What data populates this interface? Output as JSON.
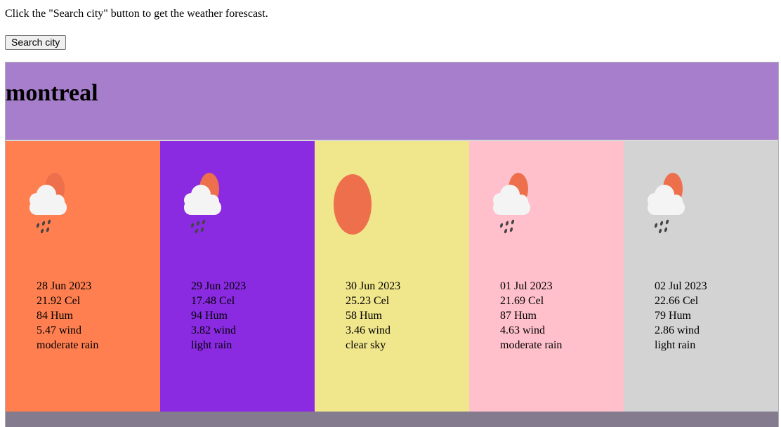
{
  "intro_text": "Click the \"Search city\" button to get the weather forescast.",
  "search_button": "Search city",
  "city": "montreal",
  "colors": {
    "header": "#a67ecb",
    "footer": "#857b8f",
    "sun": "#ee6f4c",
    "cloud": "#f4f4f4"
  },
  "days": [
    {
      "date": "28 Jun 2023",
      "temp": "21.92 Cel",
      "hum": "84 Hum",
      "wind": "5.47 wind",
      "desc": "moderate rain",
      "icon": "rain-cloud-sun-icon",
      "color": "#ff7f50"
    },
    {
      "date": "29 Jun 2023",
      "temp": "17.48 Cel",
      "hum": "94 Hum",
      "wind": "3.82 wind",
      "desc": "light rain",
      "icon": "rain-cloud-sun-icon",
      "color": "#8a2be2"
    },
    {
      "date": "30 Jun 2023",
      "temp": "25.23 Cel",
      "hum": "58 Hum",
      "wind": "3.46 wind",
      "desc": "clear sky",
      "icon": "sun-icon",
      "color": "#f0e68c"
    },
    {
      "date": "01 Jul 2023",
      "temp": "21.69 Cel",
      "hum": "87 Hum",
      "wind": "4.63 wind",
      "desc": "moderate rain",
      "icon": "rain-cloud-sun-icon",
      "color": "#ffc0cb"
    },
    {
      "date": "02 Jul 2023",
      "temp": "22.66 Cel",
      "hum": "79 Hum",
      "wind": "2.86 wind",
      "desc": "light rain",
      "icon": "rain-cloud-sun-icon",
      "color": "#d3d3d3"
    }
  ]
}
